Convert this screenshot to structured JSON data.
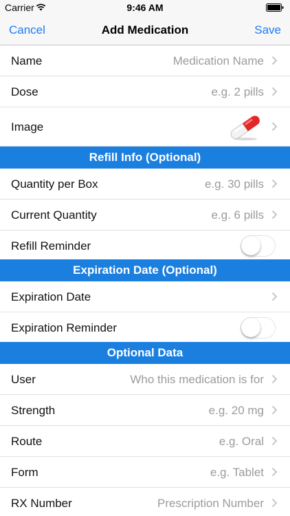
{
  "status_bar": {
    "carrier": "Carrier",
    "time": "9:46 AM",
    "wifi_icon": "wifi-icon",
    "battery_icon": "battery-icon"
  },
  "nav": {
    "cancel_label": "Cancel",
    "title": "Add Medication",
    "save_label": "Save"
  },
  "colors": {
    "accent": "#1c7cf4",
    "section_header_bg": "#1b7fe0",
    "placeholder": "#9b9ba0"
  },
  "rows": {
    "name": {
      "label": "Name",
      "value": "Medication Name"
    },
    "dose": {
      "label": "Dose",
      "value": "e.g. 2 pills"
    },
    "image": {
      "label": "Image",
      "icon": "pill-capsule-icon"
    },
    "quantity_per_box": {
      "label": "Quantity per Box",
      "value": "e.g. 30 pills"
    },
    "current_quantity": {
      "label": "Current Quantity",
      "value": "e.g. 6 pills"
    },
    "refill_reminder": {
      "label": "Refill Reminder",
      "on": false
    },
    "expiration_date": {
      "label": "Expiration Date"
    },
    "expiration_reminder": {
      "label": "Expiration Reminder",
      "on": false
    },
    "user": {
      "label": "User",
      "value": "Who this medication is for"
    },
    "strength": {
      "label": "Strength",
      "value": "e.g. 20 mg"
    },
    "route": {
      "label": "Route",
      "value": "e.g. Oral"
    },
    "form": {
      "label": "Form",
      "value": "e.g. Tablet"
    },
    "rx_number": {
      "label": "RX Number",
      "value": "Prescription Number"
    }
  },
  "sections": {
    "refill": "Refill Info (Optional)",
    "expiration": "Expiration Date (Optional)",
    "optional": "Optional Data"
  }
}
